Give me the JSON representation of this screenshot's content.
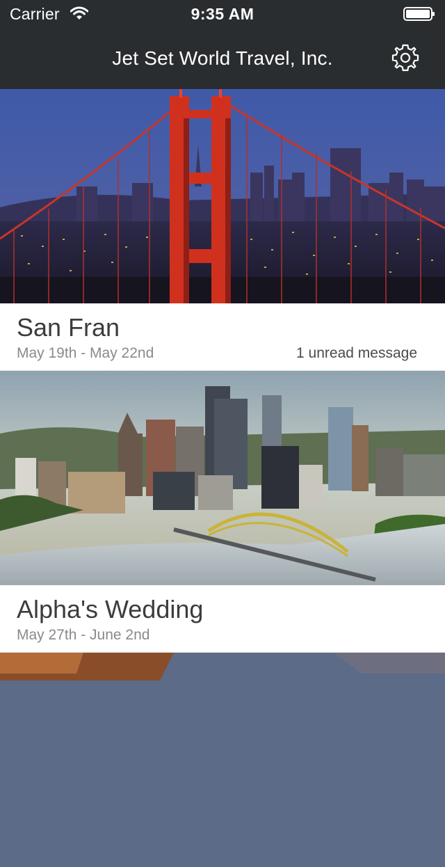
{
  "status_bar": {
    "carrier": "Carrier",
    "time": "9:35 AM",
    "wifi_icon": "wifi-icon",
    "battery_icon": "battery-icon"
  },
  "nav": {
    "title": "Jet Set World Travel, Inc.",
    "settings_icon": "gear-icon"
  },
  "trips": [
    {
      "title": "San Fran",
      "dates": "May 19th - May 22nd",
      "unread": "1 unread message",
      "image": "golden-gate-bridge-night-photo"
    },
    {
      "title": "Alpha's Wedding",
      "dates": "May 27th - June 2nd",
      "unread": "",
      "image": "pittsburgh-skyline-photo"
    },
    {
      "title": "",
      "dates": "",
      "unread": "",
      "image": "canyon-photo"
    }
  ],
  "colors": {
    "navbar_bg": "#2a2d30",
    "title_text": "#3c3c3c",
    "date_text": "#8a8a8a"
  }
}
